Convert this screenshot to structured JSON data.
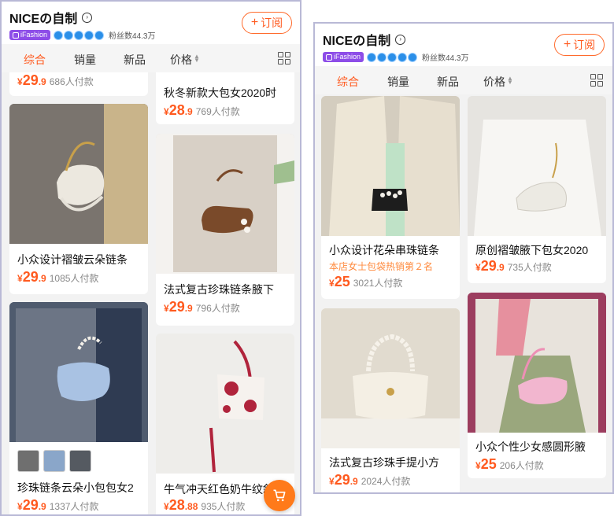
{
  "colors": {
    "accent": "#ff5a1f",
    "badge": "#8d4de8",
    "crown": "#2b8fe8"
  },
  "left": {
    "header": {
      "shop_name": "NICEの自制",
      "badge_label": "iFashion",
      "fans_label": "粉丝数44.3万",
      "subscribe_label": "订阅",
      "crown_count": 5
    },
    "tabs": [
      {
        "label": "综合",
        "active": true
      },
      {
        "label": "销量",
        "active": false
      },
      {
        "label": "新品",
        "active": false
      },
      {
        "label": "价格",
        "active": false
      }
    ],
    "products": [
      {
        "title": "",
        "price_int": "29",
        "price_dec": ".9",
        "sold": "686人付款"
      },
      {
        "title": "秋冬新款大包女2020时",
        "price_int": "28",
        "price_dec": ".9",
        "sold": "769人付款"
      },
      {
        "title": "小众设计褶皱云朵链条",
        "price_int": "29",
        "price_dec": ".9",
        "sold": "1085人付款"
      },
      {
        "title": "法式复古珍珠链条腋下",
        "price_int": "29",
        "price_dec": ".9",
        "sold": "796人付款"
      },
      {
        "title": "珍珠链条云朵小包包女2",
        "price_int": "29",
        "price_dec": ".9",
        "sold": "1337人付款"
      },
      {
        "title": "牛气冲天红色奶牛纹斜",
        "price_int": "28",
        "price_dec": ".88",
        "sold": "935人付款"
      }
    ]
  },
  "right": {
    "header": {
      "shop_name": "NICEの自制",
      "badge_label": "iFashion",
      "fans_label": "粉丝数44.3万",
      "subscribe_label": "订阅",
      "crown_count": 5
    },
    "tabs": [
      {
        "label": "综合",
        "active": true
      },
      {
        "label": "销量",
        "active": false
      },
      {
        "label": "新品",
        "active": false
      },
      {
        "label": "价格",
        "active": false
      }
    ],
    "products": [
      {
        "title": "小众设计花朵串珠链条",
        "tag": "本店女士包袋热销第２名",
        "price_int": "25",
        "price_dec": "",
        "sold": "3021人付款"
      },
      {
        "title": "原创褶皱腋下包女2020",
        "price_int": "29",
        "price_dec": ".9",
        "sold": "735人付款"
      },
      {
        "title": "法式复古珍珠手提小方",
        "price_int": "29",
        "price_dec": ".9",
        "sold": "2024人付款"
      },
      {
        "title": "小众个性少女感圆形腋",
        "price_int": "25",
        "price_dec": "",
        "sold": "206人付款"
      }
    ]
  },
  "currency": "¥"
}
